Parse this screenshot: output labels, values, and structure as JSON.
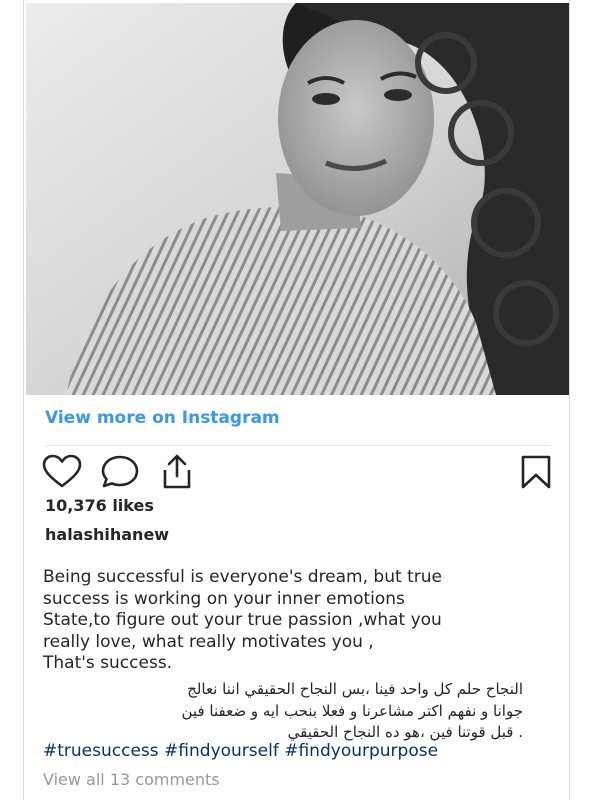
{
  "post": {
    "photo_alt": "black-and-white portrait",
    "view_more_label": "View more on Instagram",
    "likes": "10,376 likes",
    "username": "halashihanew",
    "caption_lines": [
      "Being successful is everyone's dream, but true",
      "success is working on your inner emotions",
      "State,to figure out your true passion ,what you",
      "really love, what really motivates you ,",
      "That's success."
    ],
    "arabic_lines": [
      "النجاح حلم كل واحد فينا ،بس النجاح الحقيقي اننا نعالج",
      "جوانا و نفهم اكتر مشاعرنا و فعلا بنحب ايه و ضعفنا فين",
      ". قبل قوتنا فين ،هو ده النجاح الحقيقي"
    ],
    "hashtags": [
      "#truesuccess",
      "#findyourself",
      "#findyourpurpose"
    ],
    "comments_label": "View all 13 comments"
  },
  "icons": {
    "like": "heart-icon",
    "comment": "comment-icon",
    "share": "share-icon",
    "save": "bookmark-icon"
  },
  "colors": {
    "link_blue": "#3897f0",
    "hashtag_blue": "#003569",
    "text": "#262626",
    "muted": "#999999"
  }
}
